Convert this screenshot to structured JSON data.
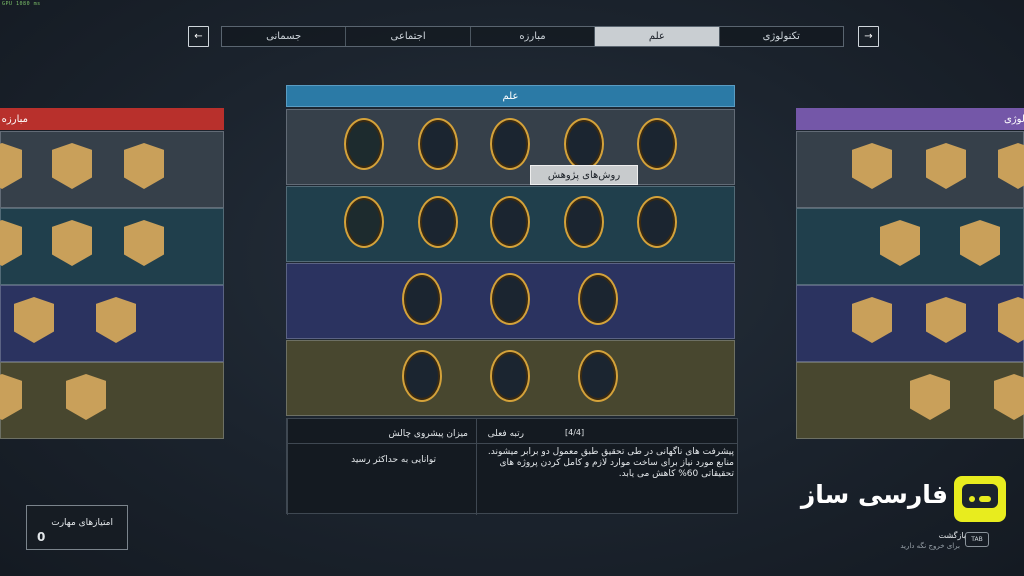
{
  "debug_text": "GPU 1080 ms",
  "tabs": [
    "تکنولوژی",
    "علم",
    "مبارزه",
    "اجتماعی",
    "جسمانی"
  ],
  "active_tab": "علم",
  "nav": {
    "prev": "←",
    "next": "→"
  },
  "center_panel": {
    "title": "علم",
    "tooltip": "روش‌های پژوهش"
  },
  "left_panel": {
    "title": "مبارزه"
  },
  "right_panel": {
    "title": "تکنولوژی"
  },
  "info": {
    "progress_label": "میزان پیشروی چالش",
    "progress_text": "توانایی به حداکثر رسید",
    "rank_label": "رتبه فعلی",
    "rank_value": "[4/4]",
    "description": "پیشرفت های ناگهانی در طی تحقیق طبق معمول دو برابر میشوند. منابع مورد نیاز برای ساخت موارد لازم و کامل کردن پروژه های تحقیقاتی 60% کاهش می یابد."
  },
  "skill_points": {
    "label": "امتیازهای مهارت",
    "value": "0"
  },
  "brand": {
    "name": "فارسی ساز",
    "accent": "#e8ec1e"
  },
  "back": {
    "key": "TAB",
    "label": "بازگشت",
    "hint": "برای خروج نگه دارید"
  },
  "colors": {
    "science": "#2b7aa6",
    "combat": "#b8302c",
    "tech": "#7457a8",
    "badge_rim": "#d4a23a"
  }
}
